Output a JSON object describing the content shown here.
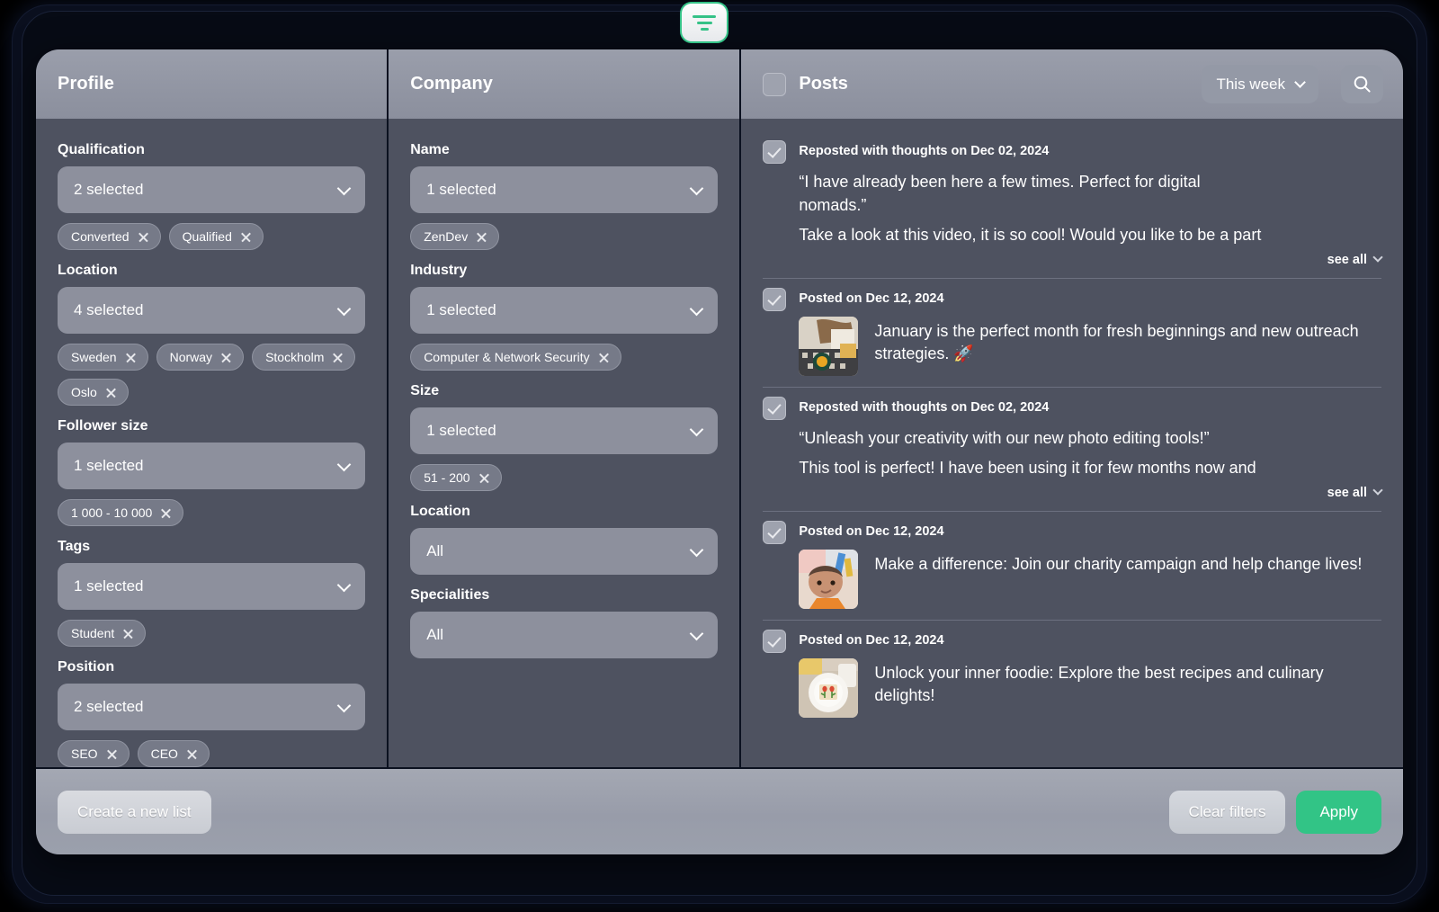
{
  "toolbar": {
    "filter_toggle_icon": "filter-icon"
  },
  "profile_panel": {
    "title": "Profile",
    "fields": [
      {
        "label": "Qualification",
        "value": "2 selected",
        "chips": [
          "Converted",
          "Qualified"
        ]
      },
      {
        "label": "Location",
        "value": "4 selected",
        "chips": [
          "Sweden",
          "Norway",
          "Stockholm",
          "Oslo"
        ]
      },
      {
        "label": "Follower size",
        "value": "1 selected",
        "chips": [
          "1 000 - 10 000"
        ]
      },
      {
        "label": "Tags",
        "value": "1 selected",
        "chips": [
          "Student"
        ]
      },
      {
        "label": "Position",
        "value": "2 selected",
        "chips": [
          "SEO",
          "CEO"
        ]
      }
    ]
  },
  "company_panel": {
    "title": "Company",
    "fields": [
      {
        "label": "Name",
        "value": "1 selected",
        "chips": [
          "ZenDev"
        ]
      },
      {
        "label": "Industry",
        "value": "1 selected",
        "chips": [
          "Computer & Network Security"
        ]
      },
      {
        "label": "Size",
        "value": "1 selected",
        "chips": [
          "51 - 200"
        ]
      },
      {
        "label": "Location",
        "value": "All",
        "chips": []
      },
      {
        "label": "Specialities",
        "value": "All",
        "chips": []
      }
    ]
  },
  "posts_panel": {
    "title": "Posts",
    "select_all_checked": false,
    "period_filter": {
      "value": "This week",
      "icon": "chevron-down-icon"
    },
    "search_icon": "search-icon",
    "see_all_label": "see all",
    "posts": [
      {
        "checked": true,
        "meta": "Reposted with thoughts on Dec 02, 2024",
        "quote": "“I have already been here a few times. Perfect for digital nomads.”",
        "body": "Take a look at this video, it is so cool! Would you like to be a part",
        "has_thumb": false,
        "has_see_all": true
      },
      {
        "checked": true,
        "meta": "Posted on Dec 12, 2024",
        "quote": "",
        "body": "January is the perfect month for fresh beginnings and new outreach strategies. 🚀",
        "has_thumb": true,
        "thumb": "desk-flatlay-photo",
        "has_see_all": false
      },
      {
        "checked": true,
        "meta": "Reposted with thoughts on Dec 02, 2024",
        "quote": "“Unleash your creativity with our new photo editing tools!”",
        "body": "This tool is perfect! I have been using it for few months now and",
        "has_thumb": false,
        "has_see_all": true
      },
      {
        "checked": true,
        "meta": "Posted on Dec 12, 2024",
        "quote": "",
        "body": "Make a difference: Join our charity campaign and help change lives!",
        "has_thumb": true,
        "thumb": "child-portrait-photo",
        "has_see_all": false
      },
      {
        "checked": true,
        "meta": "Posted on Dec 12, 2024",
        "quote": "",
        "body": "Unlock your inner foodie: Explore the best recipes and culinary delights!",
        "has_thumb": true,
        "thumb": "food-plate-photo",
        "has_see_all": false
      }
    ]
  },
  "footer": {
    "create_list_label": "Create a new list",
    "clear_filters_label": "Clear filters",
    "apply_label": "Apply"
  },
  "colors": {
    "accent_green": "#32c486",
    "panel_body": "#4e5260",
    "panel_header": "#8b8f9d",
    "chip": "#767a88"
  }
}
